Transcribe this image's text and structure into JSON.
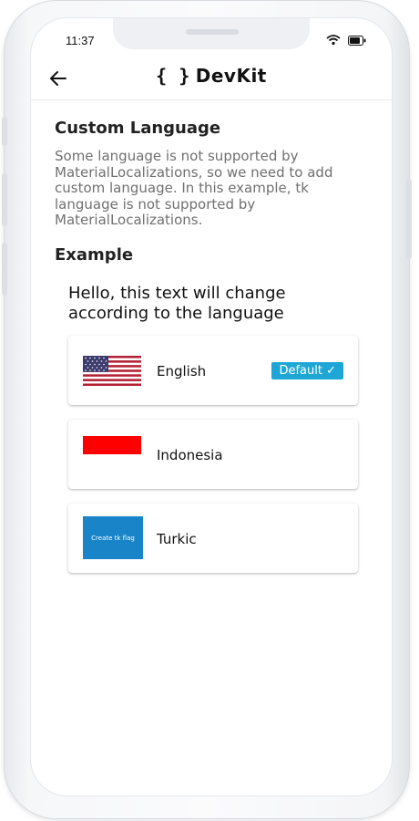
{
  "status": {
    "time": "11:37"
  },
  "appbar": {
    "brand_braces": "{ }",
    "brand_name": "DevKit"
  },
  "section": {
    "title": "Custom Language",
    "description": "Some language is not supported by MaterialLocalizations, so we need to add custom language. In this example, tk language is not supported by MaterialLocalizations."
  },
  "example": {
    "title": "Example",
    "hello": "Hello, this text will change according to the language"
  },
  "languages": [
    {
      "label": "English",
      "badge": "Default ✓",
      "flag": "us-flag"
    },
    {
      "label": "Indonesia",
      "flag": "indonesia-flag"
    },
    {
      "label": "Turkic",
      "flag": "tk-flag",
      "flag_text": "Create tk flag"
    }
  ],
  "colors": {
    "badge": "#1ea7d6",
    "tk_flag": "#1a84c9",
    "indonesia_red": "#ff0000"
  }
}
